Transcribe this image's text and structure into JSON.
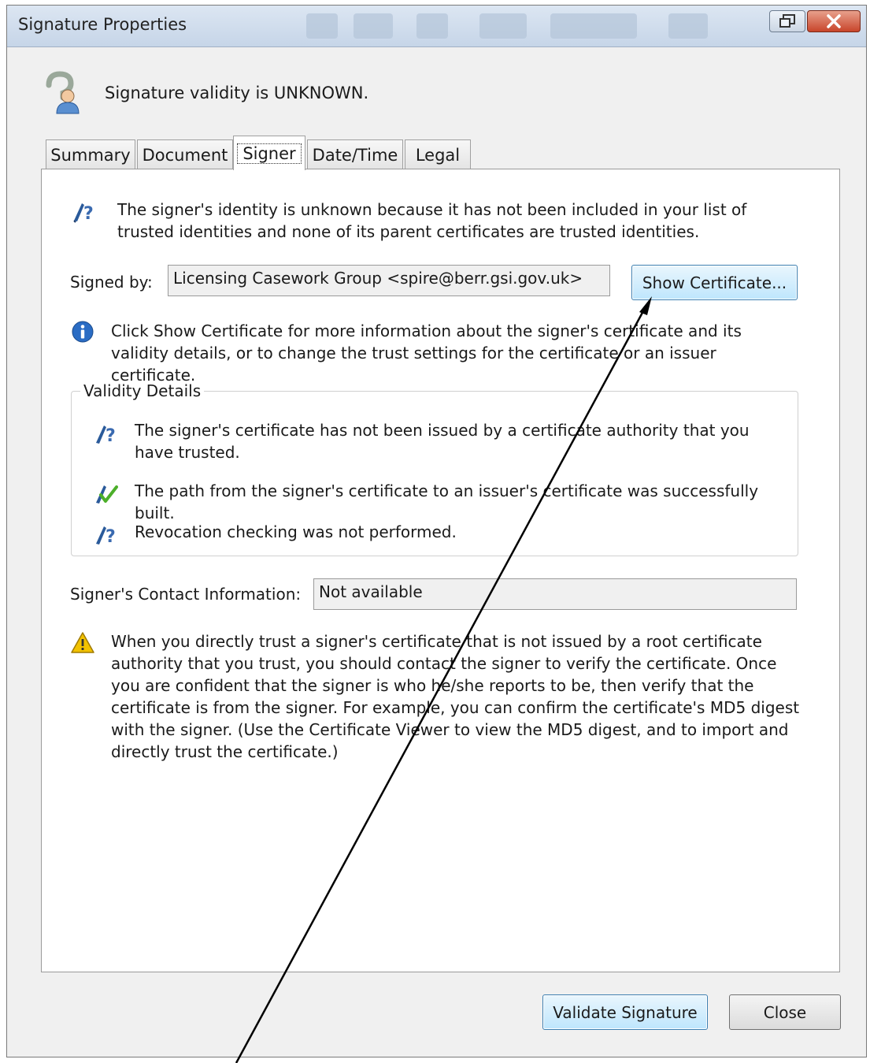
{
  "window": {
    "title": "Signature Properties",
    "restore_icon": "restore-window-icon",
    "close_icon": "close-x-icon"
  },
  "header": {
    "icon": "question-person-icon",
    "validity_text": "Signature validity is UNKNOWN."
  },
  "tabs": [
    {
      "label": "Summary",
      "active": false
    },
    {
      "label": "Document",
      "active": false
    },
    {
      "label": "Signer",
      "active": true
    },
    {
      "label": "Date/Time",
      "active": false
    },
    {
      "label": "Legal",
      "active": false
    }
  ],
  "signer": {
    "identity_icon": "pen-question-icon",
    "identity_message": "The signer's identity is unknown because it has not been included in your list of trusted identities and none of its parent certificates are trusted identities.",
    "signed_by_label": "Signed by:",
    "signed_by_value": "Licensing Casework Group <spire@berr.gsi.gov.uk>",
    "show_certificate_button": "Show Certificate...",
    "info_icon": "info-icon",
    "info_message": "Click Show Certificate for more information about the signer's certificate and its validity details, or to change the trust settings for the certificate or an issuer certificate."
  },
  "validity_details": {
    "group_label": "Validity Details",
    "items": [
      {
        "icon": "pen-question-icon",
        "text": "The signer's certificate has not been issued by a certificate authority that you have trusted."
      },
      {
        "icon": "pen-check-icon",
        "text": "The path from the signer's certificate to an issuer's certificate was successfully built."
      },
      {
        "icon": "pen-question-icon",
        "text": "Revocation checking was not performed."
      }
    ]
  },
  "contact": {
    "label": "Signer's Contact Information:",
    "value": "Not available"
  },
  "warning": {
    "icon": "warning-triangle-icon",
    "text": "When you directly trust a signer's certificate that is not issued by a root certificate authority that you trust, you should contact the signer to verify the certificate. Once you are confident that the signer is who he/she reports to be, then verify that the certificate is from the signer. For example, you can confirm the certificate's MD5 digest with the signer. (Use the Certificate Viewer to view the MD5 digest, and to import and directly trust the certificate.)"
  },
  "footer": {
    "validate_button": "Validate Signature",
    "close_button": "Close"
  },
  "colors": {
    "annotation_arrow": "#000000",
    "focus_blue": "#3c7fb1",
    "info_blue": "#2a6cc4",
    "warning_yellow": "#f2c200"
  }
}
